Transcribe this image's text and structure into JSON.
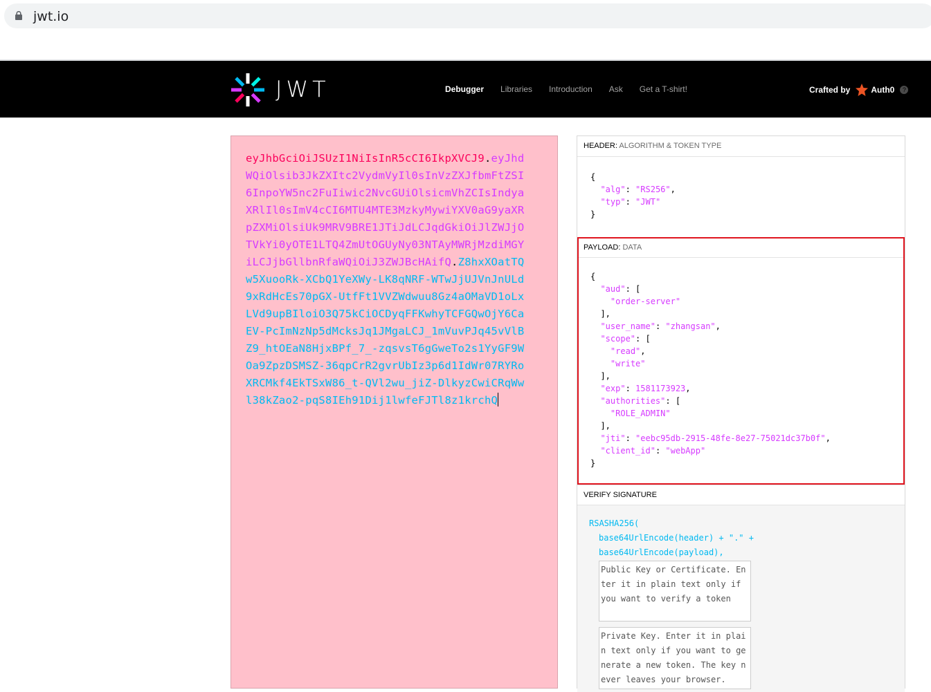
{
  "browser": {
    "url": "jwt.io"
  },
  "nav": {
    "logo_text": "JWT",
    "links": [
      "Debugger",
      "Libraries",
      "Introduction",
      "Ask",
      "Get a T-shirt!"
    ],
    "crafted_by": "Crafted by",
    "brand": "Auth0"
  },
  "encoded": {
    "header_part": "eyJhbGciOiJSUzI1NiIsInR5cCI6IkpXVCJ9",
    "payload_part": "eyJhdWQiOlsib3JkZXItc2VydmVyIl0sInVzZXJfbmFtZSI6InpoYW5nc2FuIiwic2NvcGUiOlsicmVhZCIsIndyaXRlIl0sImV4cCI6MTU4MTE3MzkyMywiYXV0aG9yaXRpZXMiOlsiUk9MRV9BRE1JTiJdLCJqdGkiOiJlZWJjOTVkYi0yOTE1LTQ4ZmUtOGUyNy03NTAyMWRjMzdiMGYiLCJjbGllbnRfaWQiOiJ3ZWJBcHAifQ",
    "signature_part": "Z8hxXOatTQw5XuooRk-XCbQ1YeXWy-LK8qNRF-WTwJjUJVnJnULd9xRdHcEs70pGX-UtfFt1VVZWdwuu8Gz4aOMaVD1oLxLVd9upBIloiO3Q75kCiOCDyqFFKwhyTCFGQwOjY6CaEV-PcImNzNp5dMcksJq1JMgaLCJ_1mVuvPJq45vVlBZ9_htOEaN8HjxBPf_7_-zqsvsT6gGweTo2s1YyGF9WOa9ZpzDSMSZ-36qpCrR2gvrUbIz3p6d1IdWr07RYRoXRCMkf4EkTSxW86_t-QVl2wu_jiZ-DlkyzCwiCRqWwl38kZao2-pqS8IEh91Dij1lwfeFJTl8z1krchQ"
  },
  "header_section": {
    "title": "HEADER:",
    "subtitle": "ALGORITHM & TOKEN TYPE",
    "alg": "RS256",
    "typ": "JWT"
  },
  "payload_section": {
    "title": "PAYLOAD:",
    "subtitle": "DATA",
    "aud": [
      "order-server"
    ],
    "user_name": "zhangsan",
    "scope": [
      "read",
      "write"
    ],
    "exp": "1581173923",
    "authorities": [
      "ROLE_ADMIN"
    ],
    "jti": "eebc95db-2915-48fe-8e27-75021dc37b0f",
    "client_id": "webApp"
  },
  "verify_section": {
    "title": "VERIFY SIGNATURE",
    "func": "RSASHA256(",
    "line1": "base64UrlEncode(header) + \".\" +",
    "line2": "base64UrlEncode(payload),",
    "public_key_placeholder": "Public Key or Certificate. Enter it in plain text only if you want to verify a token",
    "private_key_placeholder": "Private Key. Enter it in plain text only if you want to generate a new token. The key never leaves your browser."
  },
  "colors": {
    "header": "#fb015b",
    "payload": "#d63aff",
    "signature": "#00b9f1",
    "highlight": "#e0141e"
  }
}
